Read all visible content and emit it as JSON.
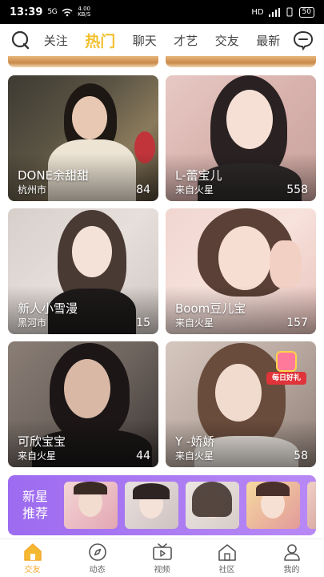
{
  "status": {
    "time": "13:39",
    "signal": "5G",
    "speed_value": "4.00",
    "speed_unit": "KB/S",
    "right": "HD",
    "battery": "50"
  },
  "header": {
    "tabs": [
      {
        "label": "关注",
        "active": false
      },
      {
        "label": "热门",
        "active": true
      },
      {
        "label": "聊天",
        "active": false
      },
      {
        "label": "才艺",
        "active": false
      },
      {
        "label": "交友",
        "active": false
      },
      {
        "label": "最新",
        "active": false
      }
    ],
    "left_icon": "search-icon",
    "right_icon": "chat-bubble-icon"
  },
  "cards": [
    {
      "name": "DONE余甜甜",
      "location": "杭州市",
      "count": "84"
    },
    {
      "name": "L-蕾宝儿",
      "location": "来自火星",
      "count": "558"
    },
    {
      "name": "新人小雪漫",
      "location": "黑河市",
      "count": "15"
    },
    {
      "name": "Boom豆儿宝",
      "location": "来自火星",
      "count": "157"
    },
    {
      "name": "可欣宝宝",
      "location": "来自火星",
      "count": "44"
    },
    {
      "name": "Y -娇娇",
      "location": "来自火星",
      "count": "58"
    }
  ],
  "gift_badge": {
    "label": "每日好礼"
  },
  "new_stars": {
    "label": "新星推荐"
  },
  "bottom_nav": [
    {
      "label": "交友",
      "icon": "home-icon",
      "active": true
    },
    {
      "label": "动态",
      "icon": "compass-icon",
      "active": false
    },
    {
      "label": "视频",
      "icon": "video-icon",
      "active": false
    },
    {
      "label": "社区",
      "icon": "community-icon",
      "active": false
    },
    {
      "label": "我的",
      "icon": "profile-icon",
      "active": false
    }
  ],
  "colors": {
    "accent": "#f3c12f",
    "nav_active": "#f3a82f",
    "banner": "#a877f2"
  }
}
